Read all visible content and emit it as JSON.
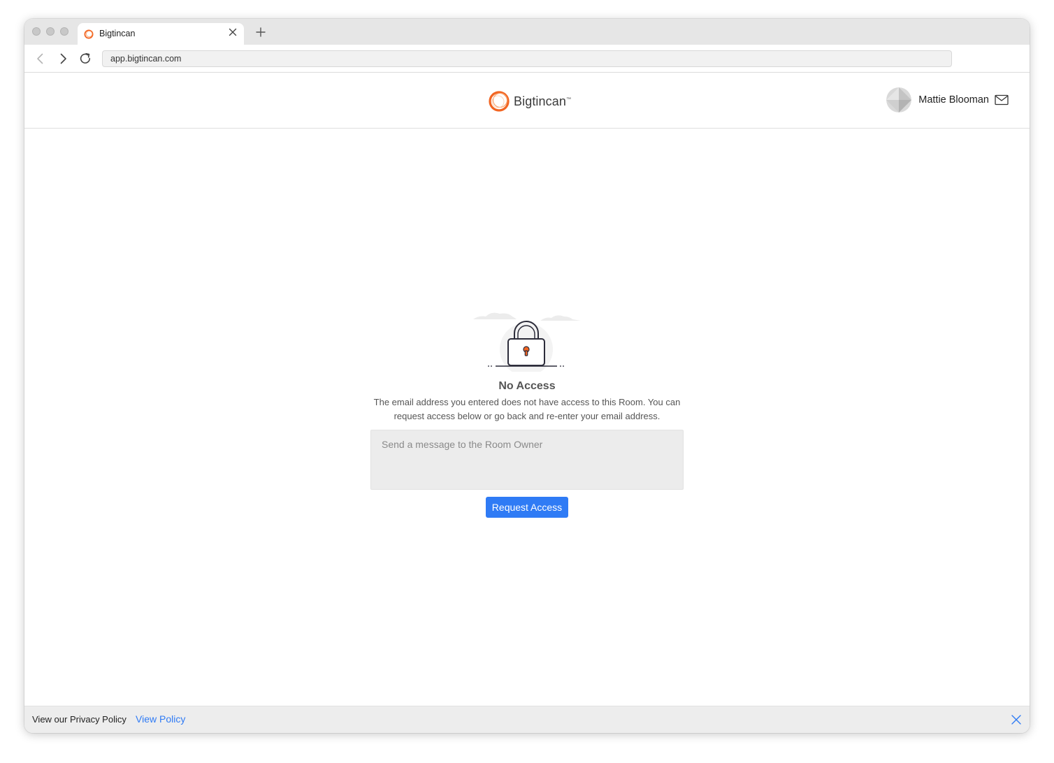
{
  "browser": {
    "tab_title": "Bigtincan",
    "url": "app.bigtincan.com"
  },
  "header": {
    "logo_text": "Bigtincan",
    "logo_tm": "™",
    "user_name": "Mattie Blooman"
  },
  "main": {
    "title": "No Access",
    "description": "The email address you entered does not have access to this Room. You can request access below or go back and re-enter your email address.",
    "message_placeholder": "Send a message to the Room Owner",
    "message_value": "",
    "request_button_label": "Request Access"
  },
  "footer": {
    "text": "View our Privacy Policy",
    "link_label": "View Policy"
  },
  "icons": {
    "favicon": "bigtincan-logo-icon",
    "tab_close": "close-icon",
    "new_tab": "plus-icon",
    "back": "chevron-left-icon",
    "forward": "chevron-right-icon",
    "reload": "reload-icon",
    "mail": "mail-icon",
    "footer_close": "close-icon",
    "illustration": "padlock-icon"
  },
  "colors": {
    "accent": "#2f7bf5",
    "brand_orange": "#f26522",
    "text_gray": "#555555"
  }
}
